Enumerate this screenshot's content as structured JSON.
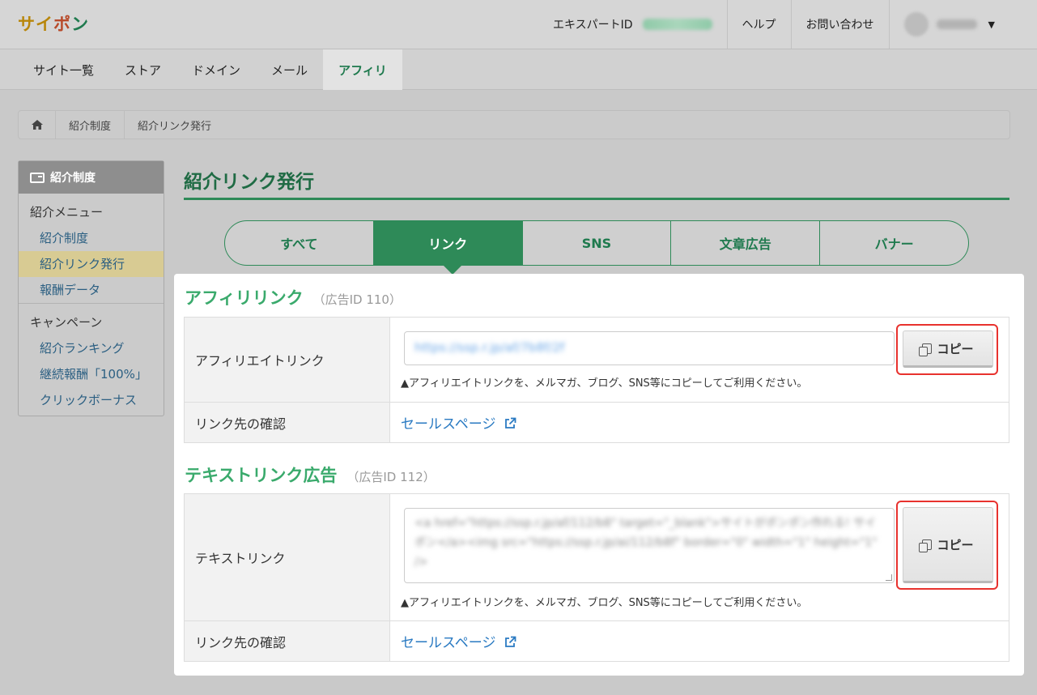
{
  "header": {
    "logo": {
      "part1": "サイ",
      "part2": "ポ",
      "part3": "ン"
    },
    "expert_label": "エキスパートID",
    "help": "ヘルプ",
    "contact": "お問い合わせ"
  },
  "main_nav": {
    "tabs": [
      "サイト一覧",
      "ストア",
      "ドメイン",
      "メール",
      "アフィリ"
    ],
    "active": "アフィリ"
  },
  "breadcrumb": {
    "items": [
      "紹介制度",
      "紹介リンク発行"
    ]
  },
  "sidebar": {
    "header": "紹介制度",
    "groups": [
      {
        "title": "紹介メニュー",
        "items": [
          "紹介制度",
          "紹介リンク発行",
          "報酬データ"
        ]
      },
      {
        "title": "キャンペーン",
        "items": [
          "紹介ランキング",
          "継続報酬「100%」",
          "クリックボーナス"
        ]
      }
    ]
  },
  "page_title": "紹介リンク発行",
  "segment_tabs": {
    "tabs": [
      "すべて",
      "リンク",
      "SNS",
      "文章広告",
      "バナー"
    ],
    "active": "リンク"
  },
  "sections": [
    {
      "title": "アフィリリンク",
      "ad_id": "（広告ID 110）",
      "row1_label": "アフィリエイトリンク",
      "field_value": "https://ssp.r.jp/af/7b8f/2f",
      "note": "▲アフィリエイトリンクを、メルマガ、ブログ、SNS等にコピーしてご利用ください。",
      "copy_label": "コピー",
      "row2_label": "リンク先の確認",
      "link_text": "セールスページ"
    },
    {
      "title": "テキストリンク広告",
      "ad_id": "（広告ID 112）",
      "row1_label": "テキストリンク",
      "field_value": "<a href=\"https://ssp.r.jp/af/112/b8\" target=\"_blank\">サイトがポンポン作れる! サイポン</a><img src=\"https://ssp.r.jp/ai/112/b8f\" border=\"0\" width=\"1\" height=\"1\" />",
      "note": "▲アフィリエイトリンクを、メルマガ、ブログ、SNS等にコピーしてご利用ください。",
      "copy_label": "コピー",
      "row2_label": "リンク先の確認",
      "link_text": "セールスページ"
    }
  ]
}
